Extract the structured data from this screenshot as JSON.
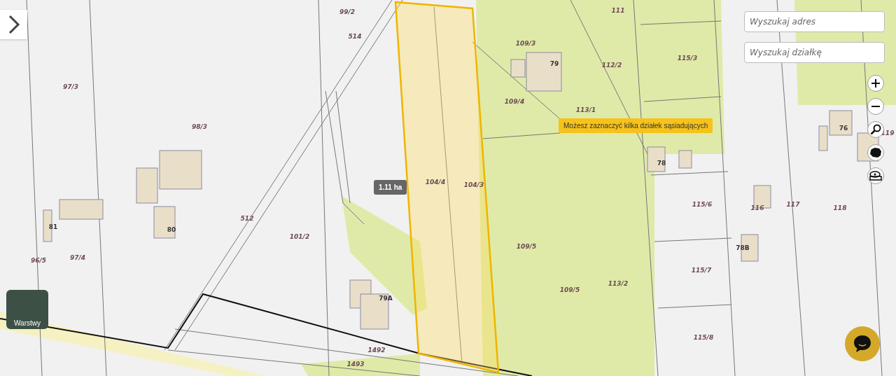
{
  "search_fields": [
    {
      "placeholder": "Wyszukaj adres"
    },
    {
      "placeholder": "Wyszukaj działkę"
    }
  ],
  "map": {
    "parcel_labels": [
      "99/2",
      "514",
      "97/3",
      "98/3",
      "109/3",
      "111",
      "112/2",
      "115/3",
      "109/4",
      "113/1",
      "104/4",
      "104/3",
      "512",
      "101/2",
      "96/5",
      "97/4",
      "109/5",
      "109/5",
      "113/2",
      "115/6",
      "116",
      "117",
      "118",
      "115/7",
      "115/8",
      "1492",
      "1493",
      "119"
    ],
    "house_numbers": [
      "79",
      "76",
      "78",
      "81",
      "80",
      "79A",
      "78B"
    ],
    "area_badge": "1.11 ha",
    "tooltip": "Możesz zaznaczyć kilka działek sąsiadujących"
  },
  "layers_button": {
    "label": "Warstwy"
  }
}
